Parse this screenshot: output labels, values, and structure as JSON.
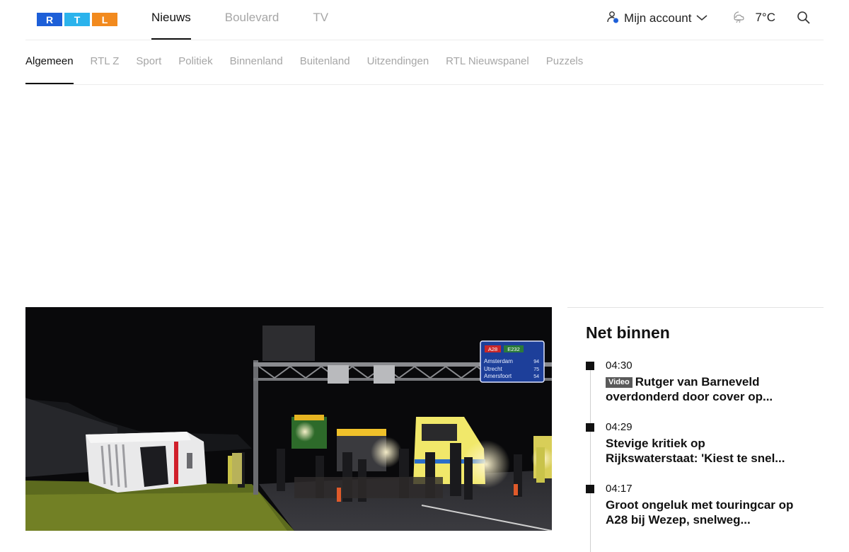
{
  "brand": {
    "letters": [
      "R",
      "T",
      "L"
    ],
    "colors": [
      "#1d5fd8",
      "#2bb3ec",
      "#f28a1e"
    ]
  },
  "main_nav": [
    {
      "label": "Nieuws",
      "active": true
    },
    {
      "label": "Boulevard",
      "active": false
    },
    {
      "label": "TV",
      "active": false
    }
  ],
  "account": {
    "label": "Mijn account",
    "icon": "user-icon"
  },
  "weather": {
    "temp": "7°C",
    "icon": "cloud-night-icon"
  },
  "search": {
    "icon": "search-icon"
  },
  "sub_nav": [
    {
      "label": "Algemeen",
      "active": true
    },
    {
      "label": "RTL Z",
      "active": false
    },
    {
      "label": "Sport",
      "active": false
    },
    {
      "label": "Politiek",
      "active": false
    },
    {
      "label": "Binnenland",
      "active": false
    },
    {
      "label": "Buitenland",
      "active": false
    },
    {
      "label": "Uitzendingen",
      "active": false
    },
    {
      "label": "RTL Nieuwspanel",
      "active": false
    },
    {
      "label": "Puzzels",
      "active": false
    }
  ],
  "hero_sign": {
    "road": "A28",
    "euro": "E232",
    "destinations": [
      {
        "city": "Amsterdam",
        "km": "94"
      },
      {
        "city": "Utrecht",
        "km": "75"
      },
      {
        "city": "Amersfoort",
        "km": "54"
      }
    ]
  },
  "net_binnen": {
    "title": "Net binnen",
    "items": [
      {
        "time": "04:30",
        "badge": "Video",
        "headline_l1": "Rutger van Barneveld",
        "headline_l2": "overdonderd door cover op..."
      },
      {
        "time": "04:29",
        "badge": "",
        "headline_l1": "Stevige kritiek op",
        "headline_l2": "Rijkswaterstaat: 'Kiest te snel..."
      },
      {
        "time": "04:17",
        "badge": "",
        "headline_l1": "Groot ongeluk met touringcar op",
        "headline_l2": "A28 bij Wezep, snelweg..."
      }
    ]
  }
}
